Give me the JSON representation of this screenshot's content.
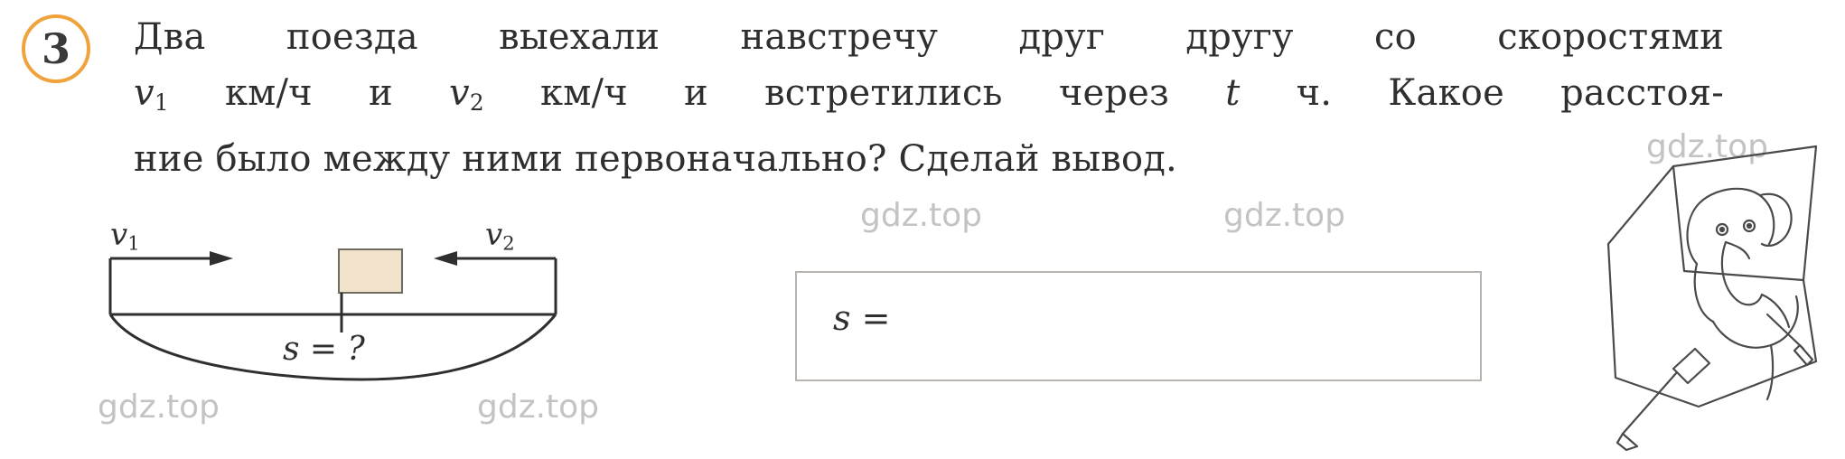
{
  "exercise": {
    "number": "3",
    "text_lines": [
      [
        "Два",
        "поезда",
        "выехали",
        "навстречу",
        "друг",
        "другу",
        "со",
        "скоростями"
      ],
      [
        "v1",
        "км/ч",
        "и",
        "v2",
        "км/ч",
        "и",
        "встретились",
        "через",
        "t",
        "ч.",
        "Какое",
        "расстоя-"
      ],
      [
        "ние было между ними первоначально? Сделай вывод."
      ]
    ],
    "full_text": "Два поезда выехали навстречу друг другу со скоростями v₁ км/ч и v₂ км/ч и встретились через t ч. Какое расстояние было между ними первоначально? Сделай вывод."
  },
  "diagram": {
    "left_speed_label": "v",
    "left_speed_sub": "1",
    "right_speed_label": "v",
    "right_speed_sub": "2",
    "distance_label": "s = ?"
  },
  "answer": {
    "equation_label": "s ="
  },
  "watermarks": [
    "gdz.top",
    "gdz.top",
    "gdz.top",
    "gdz.top",
    "gdz.top"
  ],
  "colors": {
    "badge_border": "#f0a23c",
    "text": "#2f2f2f",
    "box_border": "#b8b4ad",
    "square_fill": "#f2e3cc",
    "watermark": "#b9b9b9"
  }
}
